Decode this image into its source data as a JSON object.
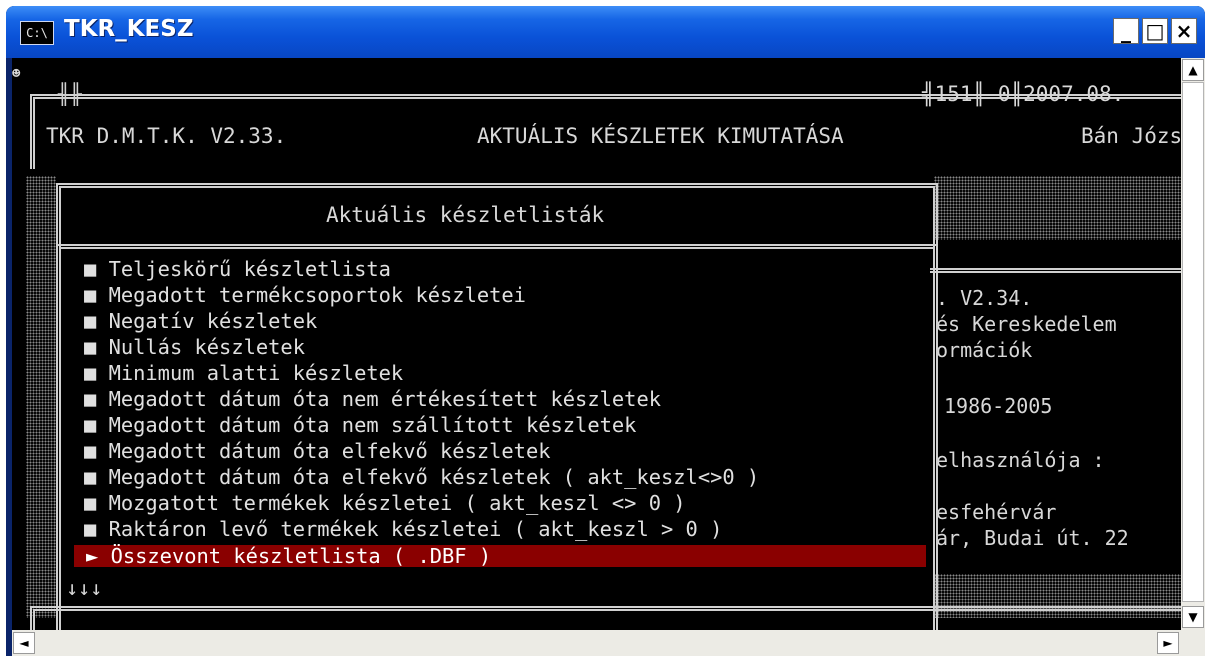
{
  "window": {
    "title": "TKR_KESZ",
    "icon_label": "C:\\",
    "minimize": "_",
    "maximize": "□",
    "close": "×"
  },
  "console": {
    "header_left": "TKR D.M.T.K. V2.33.",
    "header_center": "AKTUÁLIS KÉSZLETEK KIMUTATÁSA",
    "header_code": "╣151║ 0║2007.08.",
    "header_user": "Bán Józs",
    "top_glyph": "☻",
    "header_left_joint": "╢╟",
    "menu_title": "Aktuális készletlisták",
    "bottom_arrows": "↓↓↓",
    "bullet": "■",
    "selected_marker": "►",
    "menu_items": [
      "Teljeskörű készletlista",
      "Megadott termékcsoportok készletei",
      "Negatív készletek",
      "Nullás készletek",
      "Minimum alatti készletek",
      "Megadott dátum óta nem értékesített készletek",
      "Megadott dátum óta nem szállított készletek",
      "Megadott dátum óta elfekvő készletek",
      "Megadott dátum óta elfekvő készletek ( akt_keszl<>0 )",
      "Mozgatott termékek készletei ( akt_keszl <> 0 )",
      "Raktáron levő termékek készletei ( akt_keszl > 0 )",
      "Összevont készletlista ( .DBF )"
    ],
    "selected_index": 11,
    "right_panel": [
      ". V2.34.",
      "és Kereskedelem",
      "ormációk",
      "1986-2005",
      "elhasználója :",
      "esfehérvár",
      "ár, Budai út. 22"
    ]
  },
  "colors": {
    "selection": "#8a0000",
    "console_bg": "#000000",
    "console_text": "#d8d8d8",
    "titlebar": "#0a52d8"
  },
  "scrollbar": {
    "up": "▲",
    "down": "▼",
    "left": "◄",
    "right": "►"
  }
}
